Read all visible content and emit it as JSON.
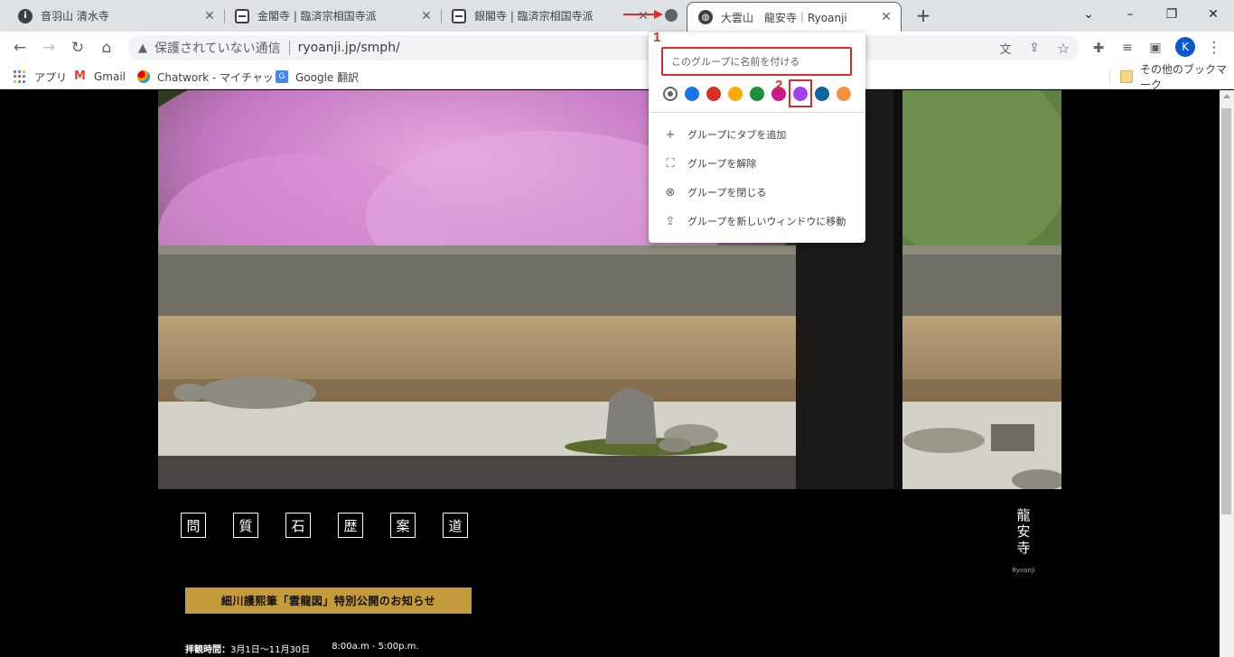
{
  "tabs": [
    {
      "title": "音羽山 清水寺"
    },
    {
      "title": "金閣寺 | 臨済宗相国寺派"
    },
    {
      "title": "銀閣寺 | 臨済宗相国寺派"
    },
    {
      "title": "大雲山　龍安寺｜Ryoanji"
    }
  ],
  "window_controls": {
    "minimize": "–",
    "restore": "❐",
    "close": "✕",
    "tab_search": "⌄"
  },
  "toolbar": {
    "back": "←",
    "forward": "→",
    "reload": "↻",
    "home": "⌂"
  },
  "omnibox": {
    "security": "保護されていない通信",
    "url": "ryoanji.jp/smph/"
  },
  "profile": {
    "initial": "K"
  },
  "bookmarks": [
    {
      "label": "アプリ"
    },
    {
      "label": "Gmail"
    },
    {
      "label": "Chatwork - マイチャット"
    },
    {
      "label": "Google 翻訳"
    }
  ],
  "other_bookmarks": "その他のブックマーク",
  "group_popup": {
    "name_placeholder": "このグループに名前を付ける",
    "colors": [
      "#5f6368",
      "#1a73e8",
      "#d93025",
      "#f9ab00",
      "#1e8e3e",
      "#d01884",
      "#a142f4",
      "#12659c",
      "#fa903e"
    ],
    "selected_color_index": 0,
    "menu": [
      {
        "icon": "+",
        "label": "グループにタブを追加"
      },
      {
        "icon": "⛶",
        "label": "グループを解除"
      },
      {
        "icon": "⊗",
        "label": "グループを閉じる"
      },
      {
        "icon": "⇪",
        "label": "グループを新しいウィンドウに移動"
      }
    ]
  },
  "annotations": {
    "step1": "1",
    "step2": "2"
  },
  "page": {
    "nav_kanji": [
      "問",
      "質",
      "石",
      "歴",
      "案",
      "道"
    ],
    "brand_kanji": [
      "龍",
      "安",
      "寺"
    ],
    "brand_sub": "Ryoanji",
    "notice": "細川護熙筆「雲龍図」特別公開のお知らせ",
    "hours_label": "拝観時間：",
    "hours_dates": "3月1日〜11月30日",
    "hours_time": "8:00a.m - 5:00p.m."
  }
}
